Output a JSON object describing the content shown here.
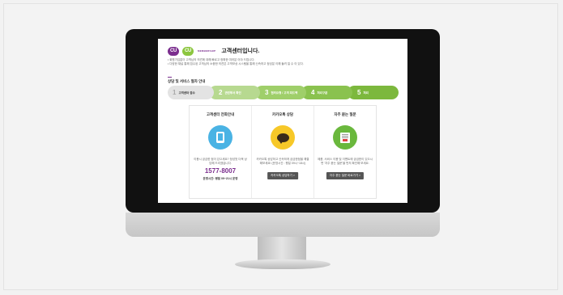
{
  "header": {
    "logo_primary": "CU",
    "logo_secondary": "CU",
    "membership_label": "MEMBERSHIP",
    "title": "고객센터입니다."
  },
  "notices": [
    "• 회원가입없이 고객님의 의견에 대해 빠르고 정확한 여러분 이야 드립니다.",
    "• 다양한 채널 통해 접수된 고객님의 소중한 의견은 고객보상 시스템을 통해 신속하고 정성분 이해 돌려 일 수 이 있다."
  ],
  "section": {
    "title": "상담 및 서비스 절차 안내"
  },
  "steps": [
    {
      "num": "1",
      "label": "고객센터 접수"
    },
    {
      "num": "2",
      "label": "관련부서 확인"
    },
    {
      "num": "3",
      "label": "협의요청 / 고객 피드백"
    },
    {
      "num": "4",
      "label": "처리구분"
    },
    {
      "num": "5",
      "label": "처리"
    }
  ],
  "panels": {
    "call": {
      "title": "고객센터 전화안내",
      "desc": "이용시 궁금한 점이 있으세요? 정성껏 더욱 상담해 드리겠습니다.",
      "phone": "1577-8007",
      "hours": "운영시간: 평일 09~21시 운영",
      "icon": "tablet-icon"
    },
    "kakao": {
      "title": "카카오톡 상담",
      "desc": "카카오톡 상담하고 신속하게 궁금한점을 해결해보세요! (운영시간 : 평일 09시~18시)",
      "button": "카카오톡 상담하기 >",
      "icon": "chat-bubble-icon"
    },
    "faq": {
      "title": "자주 묻는 질문",
      "desc": "제품, 서비스 이용 및 이벤트에 궁금한이 있으시면 '자주 묻는 질문'을 먼저 확인해 보세요.",
      "button": "자주 묻는 질문 바로가기 >",
      "icon": "faq-card-icon"
    }
  },
  "colors": {
    "brand_purple": "#7b2e8e",
    "brand_green": "#8cc63f",
    "blue_circle": "#4ab3e4",
    "yellow_circle": "#f7c828",
    "green_circle": "#6ab83d"
  }
}
